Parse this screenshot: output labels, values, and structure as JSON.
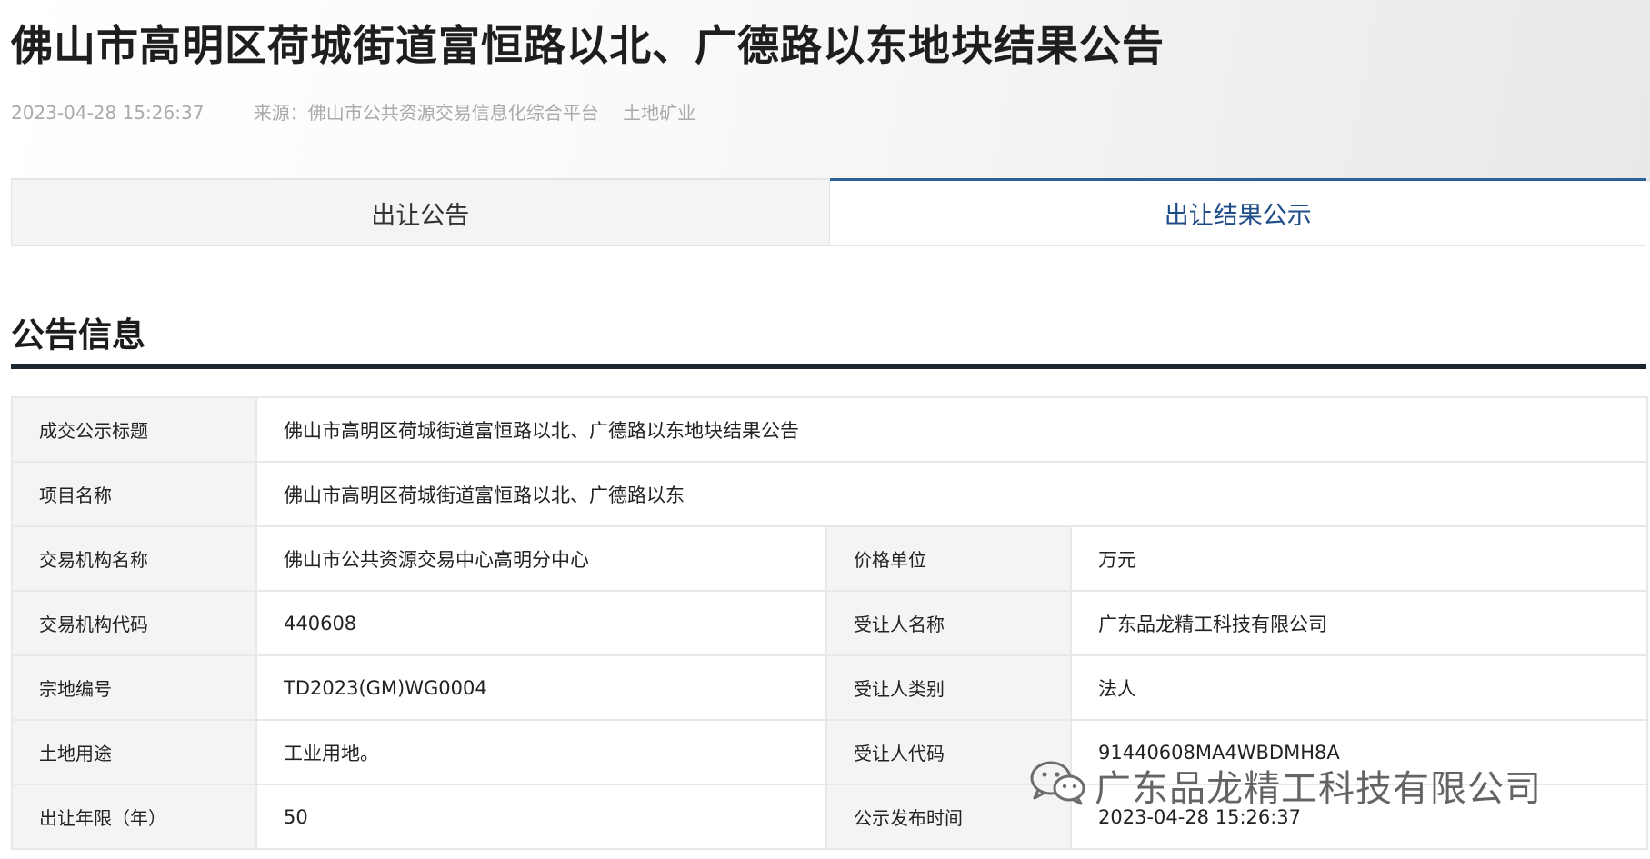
{
  "page": {
    "title": "佛山市高明区荷城街道富恒路以北、广德路以东地块结果公告",
    "date": "2023-04-28 15:26:37",
    "source_label": "来源：佛山市公共资源交易信息化综合平台",
    "category": "土地矿业"
  },
  "tabs": [
    {
      "label": "出让公告",
      "active": false
    },
    {
      "label": "出让结果公示",
      "active": true
    }
  ],
  "section": {
    "title": "公告信息"
  },
  "table": {
    "row1": {
      "label": "成交公示标题",
      "value": "佛山市高明区荷城街道富恒路以北、广德路以东地块结果公告"
    },
    "row2": {
      "label": "项目名称",
      "value": "佛山市高明区荷城街道富恒路以北、广德路以东"
    },
    "row3": {
      "label1": "交易机构名称",
      "value1": "佛山市公共资源交易中心高明分中心",
      "label2": "价格单位",
      "value2": "万元"
    },
    "row4": {
      "label1": "交易机构代码",
      "value1": "440608",
      "label2": "受让人名称",
      "value2": "广东品龙精工科技有限公司"
    },
    "row5": {
      "label1": "宗地编号",
      "value1": "TD2023(GM)WG0004",
      "label2": "受让人类别",
      "value2": "法人"
    },
    "row6": {
      "label1": "土地用途",
      "value1": "工业用地。",
      "label2": "受让人代码",
      "value2": "91440608MA4WBDMH8A"
    },
    "row7": {
      "label1": "出让年限（年）",
      "value1": "50",
      "label2": "公示发布时间",
      "value2": "2023-04-28 15:26:37"
    }
  },
  "watermark": {
    "text": "广东品龙精工科技有限公司",
    "icon": "wechat-icon"
  }
}
